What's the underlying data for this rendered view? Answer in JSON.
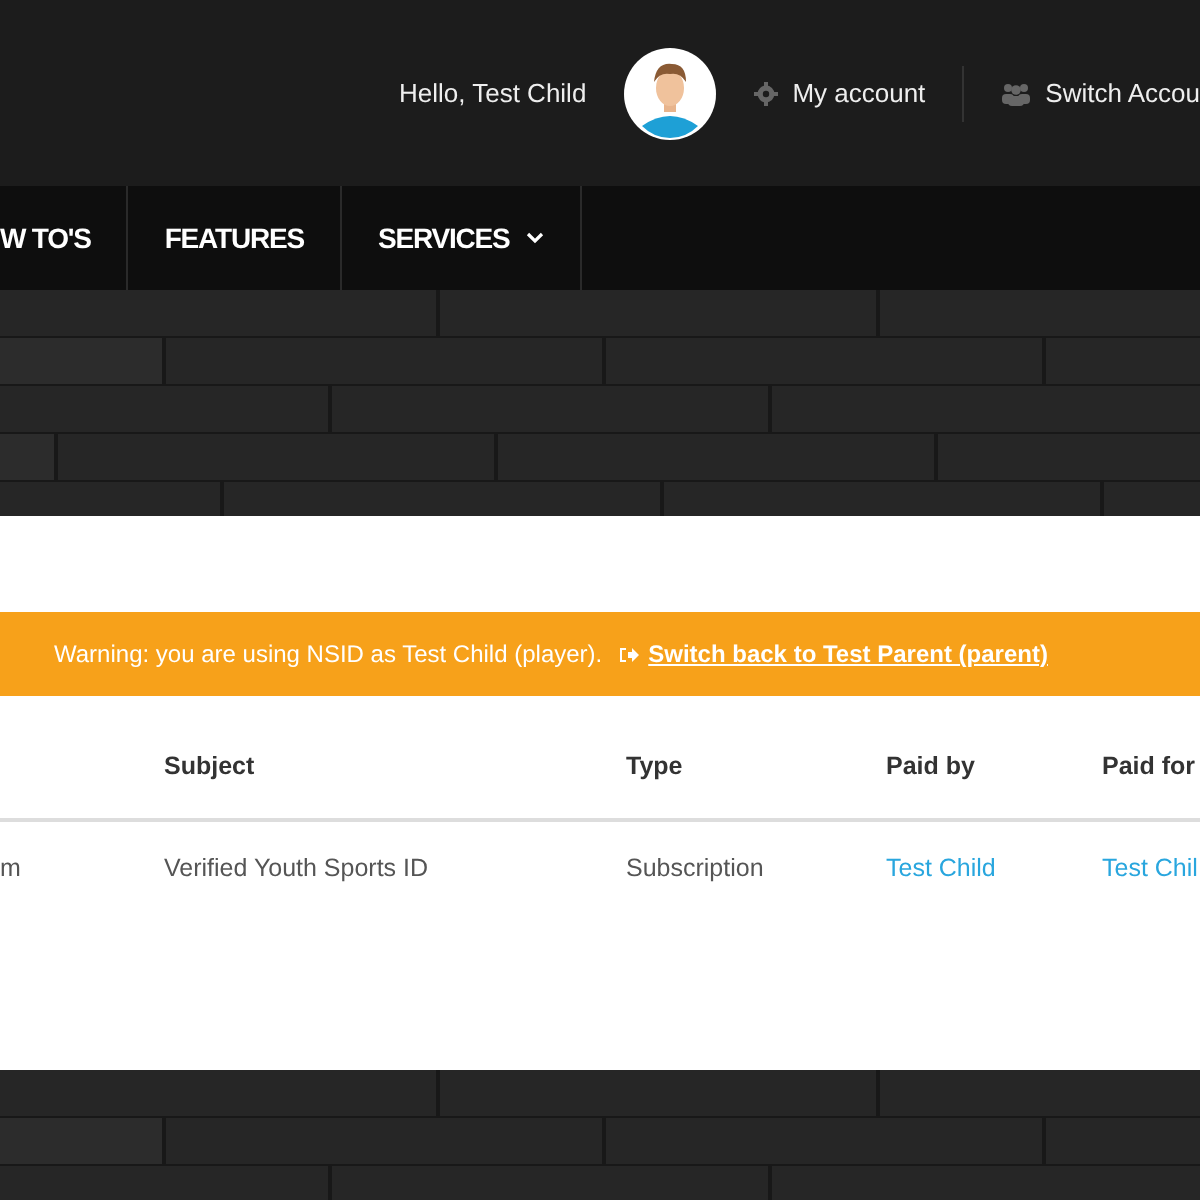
{
  "header": {
    "greeting": "Hello, Test Child",
    "account_link": "My account",
    "switch_link": "Switch Accou"
  },
  "nav": {
    "items": [
      {
        "label": "W TO'S",
        "has_menu": false
      },
      {
        "label": "FEATURES",
        "has_menu": false
      },
      {
        "label": "SERVICES",
        "has_menu": true
      }
    ]
  },
  "warning": {
    "message": "Warning: you are using NSID as Test Child (player).",
    "link": "Switch back to Test Parent (parent)"
  },
  "table": {
    "columns": [
      "",
      "Subject",
      "Type",
      "Paid by",
      "Paid for"
    ],
    "rows": [
      {
        "column_1": "m",
        "subject": "Verified Youth Sports ID",
        "type": "Subscription",
        "paid_by": "Test Child",
        "paid_for": "Test Chil"
      }
    ]
  }
}
